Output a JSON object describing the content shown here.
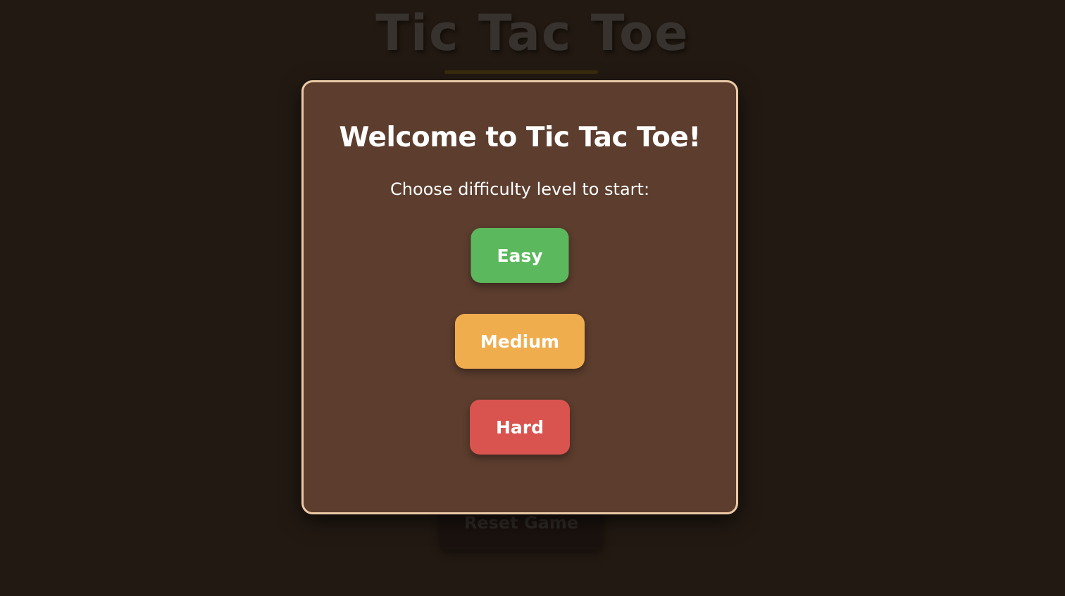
{
  "game": {
    "title": "Tic Tac Toe",
    "reset_label": "Reset Game"
  },
  "modal": {
    "title": "Welcome to Tic Tac Toe!",
    "subtitle": "Choose difficulty level to start:",
    "buttons": [
      {
        "label": "Easy",
        "color": "#5cb85c"
      },
      {
        "label": "Medium",
        "color": "#f0ad4e"
      },
      {
        "label": "Hard",
        "color": "#d9534f"
      }
    ]
  },
  "colors": {
    "background": "#2a1f17",
    "modal_background": "#5c3d2e",
    "modal_border": "#ecc9a6"
  }
}
